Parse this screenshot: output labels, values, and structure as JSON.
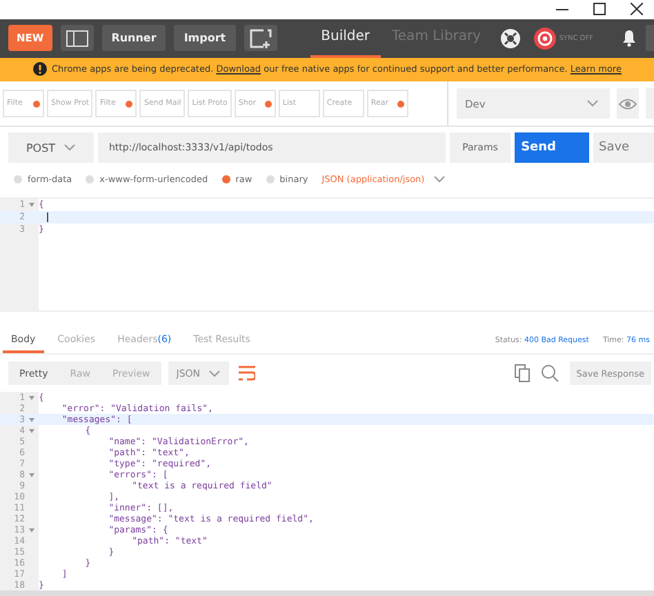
{
  "toolbar": {
    "new_label": "NEW",
    "runner_label": "Runner",
    "import_label": "Import",
    "tabs": [
      {
        "label": "Builder",
        "selected": true
      },
      {
        "label": "Team Library",
        "selected": false
      }
    ],
    "sync_label": "SYNC OFF"
  },
  "banner": {
    "text": "Chrome apps are being deprecated.",
    "link": "Download",
    "text2": "our free native apps for continued support and better performance.",
    "link2": "Learn more"
  },
  "request_tabs": [
    {
      "label": "Filte",
      "modified": true
    },
    {
      "label": "Show Prot",
      "modified": false
    },
    {
      "label": "Filte",
      "modified": true
    },
    {
      "label": "Send Mail",
      "modified": false
    },
    {
      "label": "List Proto",
      "modified": false
    },
    {
      "label": "Shor",
      "modified": true
    },
    {
      "label": "List",
      "modified": false
    },
    {
      "label": "Create",
      "modified": false
    },
    {
      "label": "Rear",
      "modified": true
    }
  ],
  "environment": "Dev",
  "request": {
    "method": "POST",
    "url": "http://localhost:3333/v1/api/todos",
    "params_label": "Params",
    "send_label": "Send",
    "save_label": "Save"
  },
  "body_types": [
    {
      "label": "form-data",
      "selected": false
    },
    {
      "label": "x-www-form-urlencoded",
      "selected": false
    },
    {
      "label": "raw",
      "selected": true
    },
    {
      "label": "binary",
      "selected": false
    }
  ],
  "content_type": "JSON (application/json)",
  "request_body": [
    {
      "number": "1",
      "text": "{",
      "foldable": true,
      "active": false
    },
    {
      "number": "2",
      "foldable": false,
      "active": true
    },
    {
      "number": "3",
      "text": "}",
      "foldable": false,
      "active": false
    }
  ],
  "response_tabs": [
    {
      "label": "Body",
      "selected": true
    },
    {
      "label": "Cookies",
      "selected": false
    },
    {
      "label": "Headers",
      "count": "(6)",
      "selected": false
    },
    {
      "label": "Test Results",
      "selected": false
    }
  ],
  "status": {
    "label": "Status:",
    "value": "400 Bad Request",
    "time_label": "Time:",
    "time_value": "76 ms"
  },
  "view_modes": [
    {
      "label": "Pretty",
      "selected": true
    },
    {
      "label": "Raw",
      "selected": false
    },
    {
      "label": "Preview",
      "selected": false
    }
  ],
  "format": "JSON",
  "save_response_label": "Save Response",
  "response_body": [
    {
      "number": "1",
      "text": "{",
      "foldable": true,
      "active": false,
      "children": [
        {
          "number": "2",
          "text": "\"error\": \"Validation fails\",",
          "foldable": false,
          "active": false
        },
        {
          "number": "3",
          "text": "\"messages\": [",
          "foldable": true,
          "active": true,
          "children": [
            {
              "number": "4",
              "text": "{",
              "foldable": true,
              "active": false,
              "children": [
                {
                  "number": "5",
                  "text": "\"name\": \"ValidationError\",",
                  "foldable": false,
                  "active": false
                },
                {
                  "number": "6",
                  "text": "\"path\": \"text\",",
                  "foldable": false,
                  "active": false
                },
                {
                  "number": "7",
                  "text": "\"type\": \"required\",",
                  "foldable": false,
                  "active": false
                },
                {
                  "number": "8",
                  "text": "\"errors\": [",
                  "foldable": true,
                  "active": false,
                  "children": [
                    {
                      "number": "9",
                      "text": "\"text is a required field\"",
                      "foldable": false,
                      "active": false
                    }
                  ]
                },
                {
                  "number": "10",
                  "text": "],",
                  "foldable": false,
                  "active": false
                },
                {
                  "number": "11",
                  "text": "\"inner\": [],",
                  "foldable": false,
                  "active": false
                },
                {
                  "number": "12",
                  "text": "\"message\": \"text is a required field\",",
                  "foldable": false,
                  "active": false
                },
                {
                  "number": "13",
                  "text": "\"params\": {",
                  "foldable": true,
                  "active": false,
                  "children": [
                    {
                      "number": "14",
                      "text": "\"path\": \"text\"",
                      "foldable": false,
                      "active": false
                    }
                  ]
                },
                {
                  "number": "15",
                  "text": "}",
                  "foldable": false,
                  "active": false
                }
              ]
            },
            {
              "number": "16",
              "text": "}",
              "foldable": false,
              "active": false
            }
          ]
        },
        {
          "number": "17",
          "text": "]",
          "foldable": false,
          "active": false
        }
      ]
    },
    {
      "number": "18",
      "text": "}",
      "foldable": false,
      "active": false
    }
  ]
}
